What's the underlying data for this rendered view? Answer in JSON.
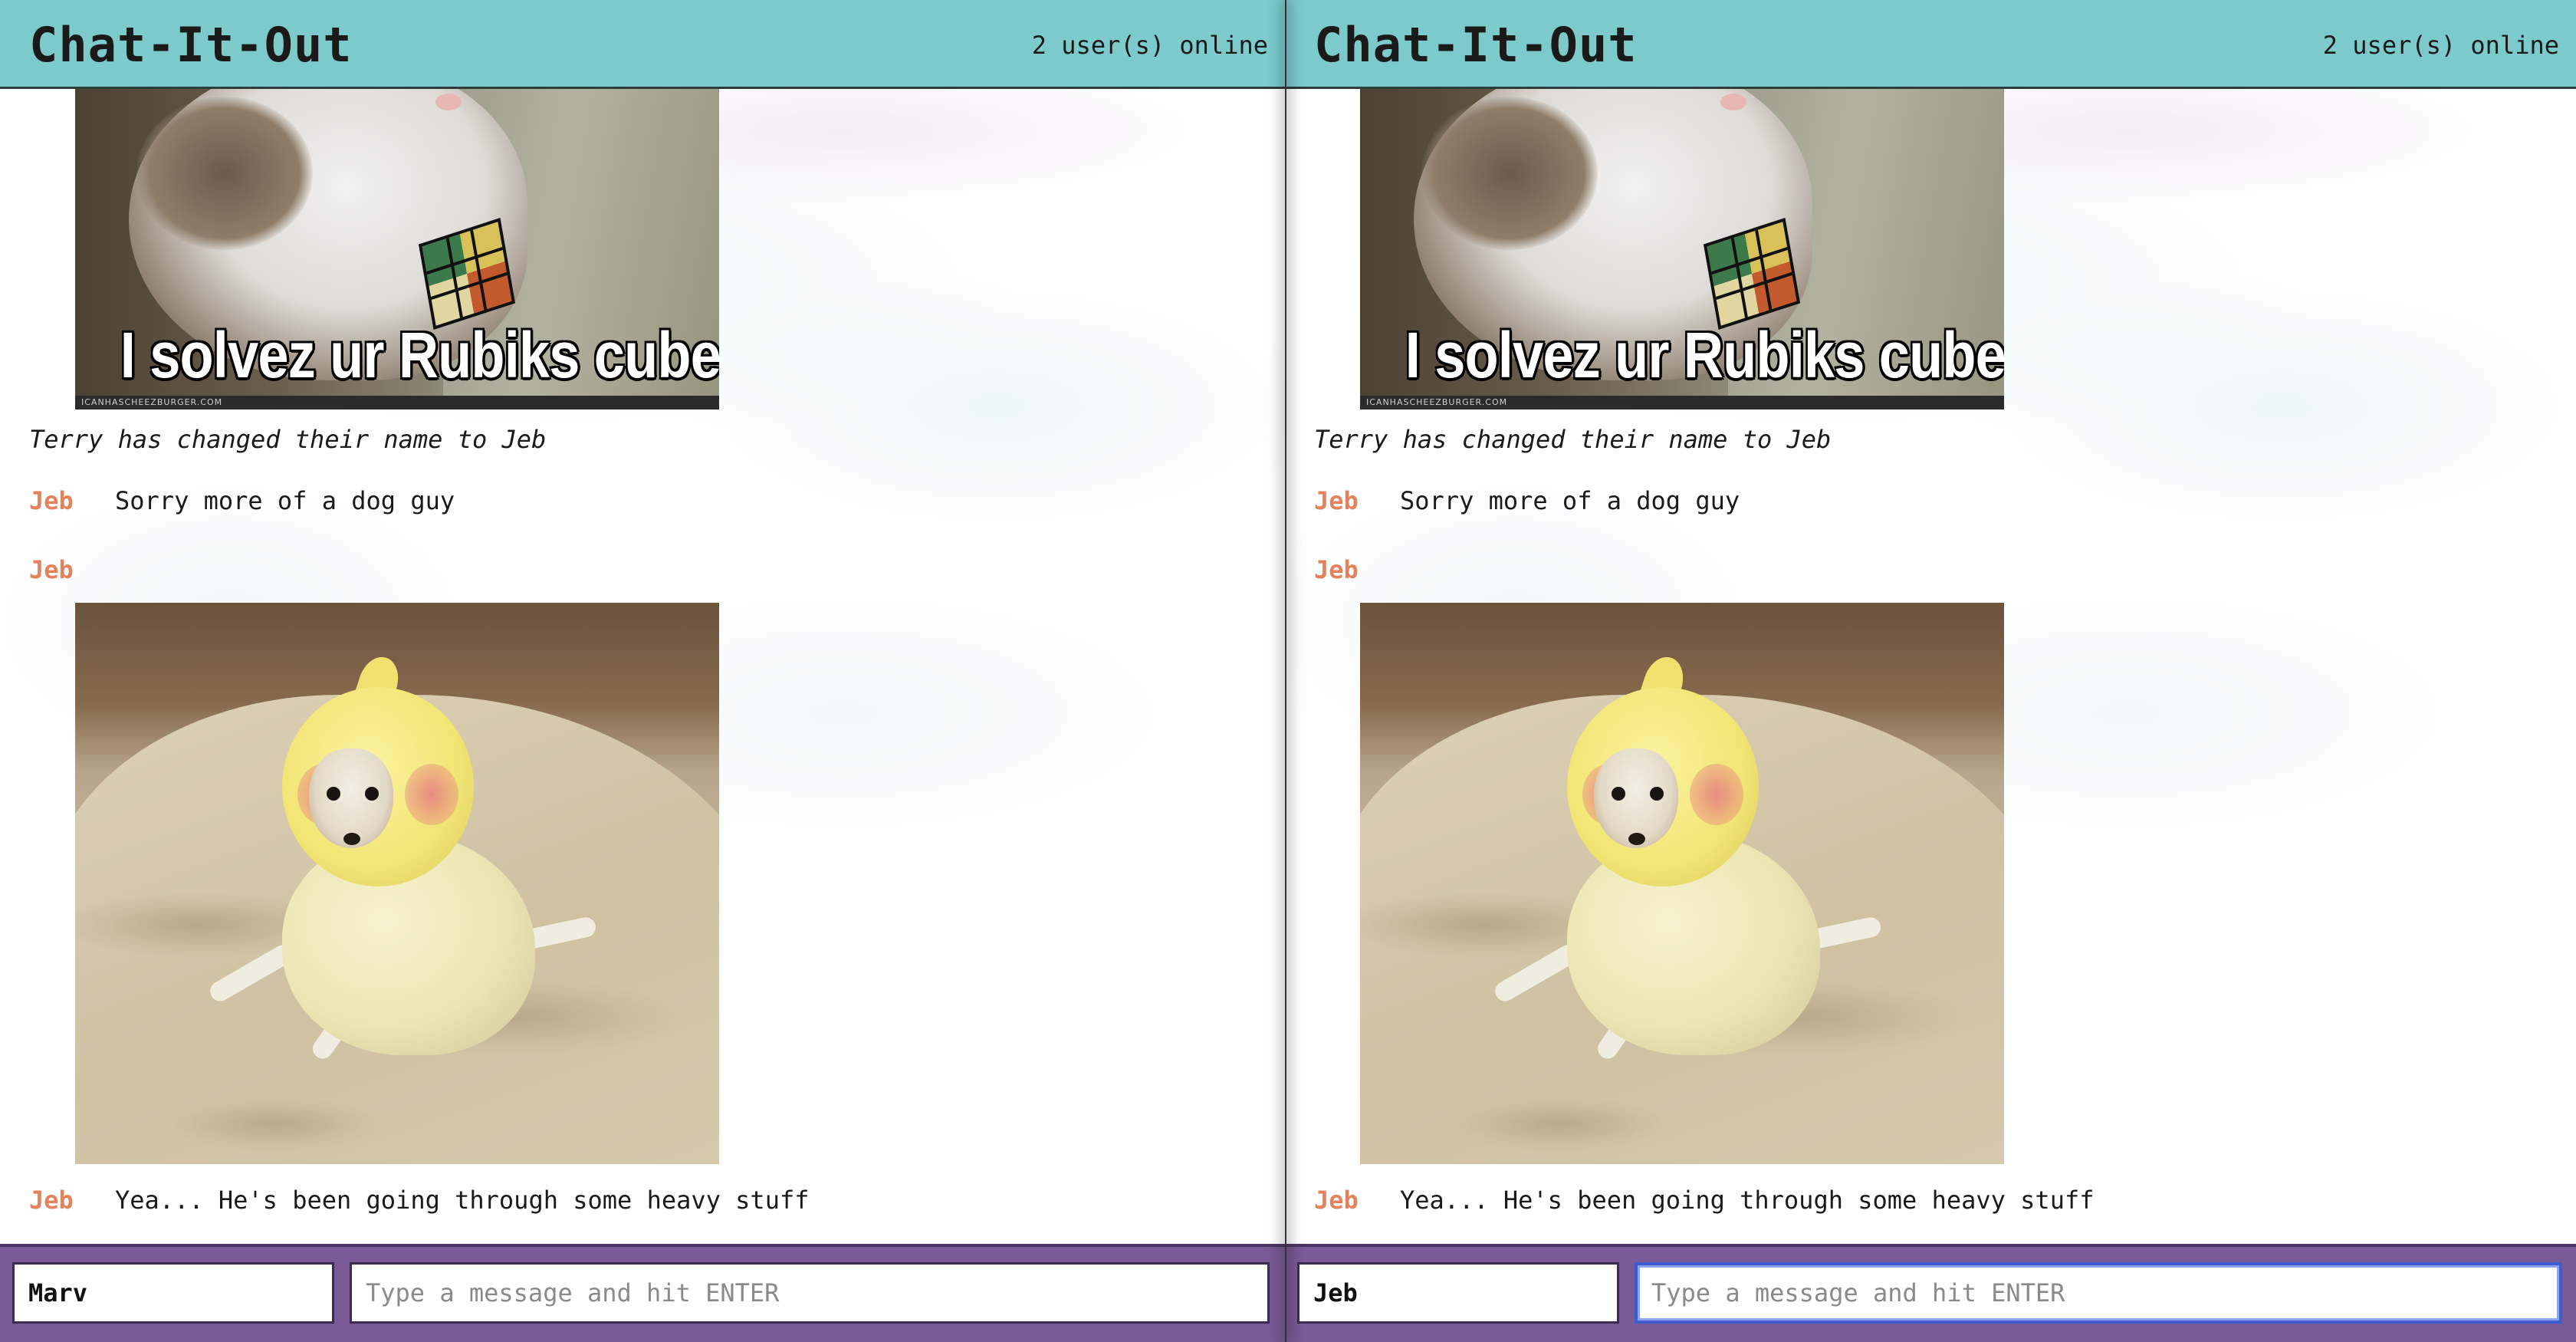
{
  "panes": [
    {
      "id": "left",
      "header": {
        "title": "Chat-It-Out",
        "online": "2 user(s) online"
      },
      "messages": {
        "image1": {
          "caption": "I solvez ur Rubiks cube",
          "watermark": "ICANHASCHEEZBURGER.COM"
        },
        "system": "Terry has changed their name to Jeb",
        "msg1": {
          "author": "Jeb",
          "text": "Sorry more of a dog guy"
        },
        "msg2": {
          "author": "Jeb"
        },
        "msg3": {
          "author": "Jeb",
          "text": "Yea... He's been going through some heavy stuff"
        }
      },
      "footer": {
        "name_value": "Marv",
        "message_placeholder": "Type a message and hit ENTER"
      }
    },
    {
      "id": "right",
      "header": {
        "title": "Chat-It-Out",
        "online": "2 user(s) online"
      },
      "messages": {
        "image1": {
          "caption": "I solvez ur Rubiks cube",
          "watermark": "ICANHASCHEEZBURGER.COM"
        },
        "system": "Terry has changed their name to Jeb",
        "msg1": {
          "author": "Jeb",
          "text": "Sorry more of a dog guy"
        },
        "msg2": {
          "author": "Jeb"
        },
        "msg3": {
          "author": "Jeb",
          "text": "Yea... He's been going through some heavy stuff"
        }
      },
      "footer": {
        "name_value": "Jeb",
        "message_placeholder": "Type a message and hit ENTER"
      }
    }
  ],
  "theme": {
    "header_color": "#7dcacb",
    "footer_color": "#7a5a96",
    "author_color": "#e4825c"
  }
}
